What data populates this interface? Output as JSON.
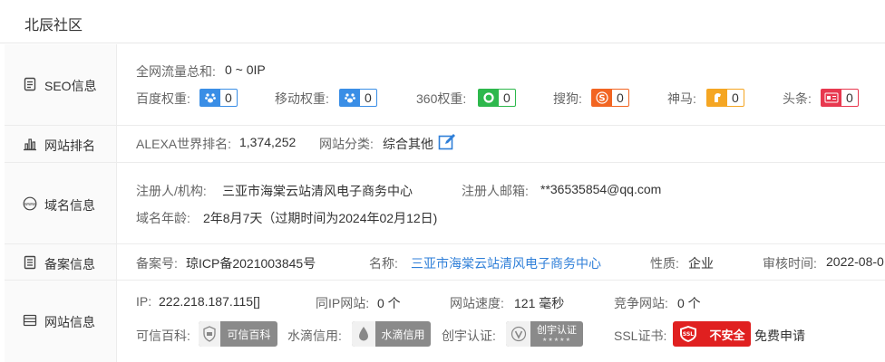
{
  "page_title": "北辰社区",
  "seo": {
    "label": "SEO信息",
    "traffic_label": "全网流量总和:",
    "traffic_value": "0 ~ 0IP",
    "ranks": [
      {
        "name": "百度权重:",
        "value": "0",
        "color": "#3a8ee6"
      },
      {
        "name": "移动权重:",
        "value": "0",
        "color": "#3a8ee6"
      },
      {
        "name": "360权重:",
        "value": "0",
        "color": "#2db84c"
      },
      {
        "name": "搜狗:",
        "value": "0",
        "color": "#f26522"
      },
      {
        "name": "神马:",
        "value": "0",
        "color": "#f5a623"
      },
      {
        "name": "头条:",
        "value": "0",
        "color": "#e8384f"
      }
    ]
  },
  "ranking": {
    "label": "网站排名",
    "alexa_label": "ALEXA世界排名:",
    "alexa_value": "1,374,252",
    "category_label": "网站分类:",
    "category_value": "综合其他"
  },
  "domain": {
    "label": "域名信息",
    "registrant_label": "注册人/机构:",
    "registrant_value": "三亚市海棠云站清风电子商务中心",
    "email_label": "注册人邮箱:",
    "email_value": "**36535854@qq.com",
    "age_label": "域名年龄:",
    "age_value": "2年8月7天（过期时间为2024年02月12日)"
  },
  "icp": {
    "label": "备案信息",
    "number_label": "备案号:",
    "number_value": "琼ICP备2021003845号",
    "name_label": "名称:",
    "name_value": "三亚市海棠云站清风电子商务中心",
    "nature_label": "性质:",
    "nature_value": "企业",
    "audit_label": "审核时间:",
    "audit_value": "2022-08-0"
  },
  "site": {
    "label": "网站信息",
    "ip_label": "IP:",
    "ip_value": "222.218.187.115[]",
    "sameip_label": "同IP网站:",
    "sameip_value": "0 个",
    "speed_label": "网站速度:",
    "speed_value": "121 毫秒",
    "compete_label": "竞争网站:",
    "compete_value": "0 个",
    "baike_label": "可信百科:",
    "baike_badge": "可信百科",
    "shuidi_label": "水滴信用:",
    "shuidi_badge": "水滴信用",
    "chuangyu_label": "创宇认证:",
    "chuangyu_badge": "创宇认证",
    "chuangyu_stars": "★★★★★",
    "ssl_label": "SSL证书:",
    "ssl_icon_text": "SSL",
    "ssl_status": "不安全",
    "ssl_apply": "免费申请"
  }
}
